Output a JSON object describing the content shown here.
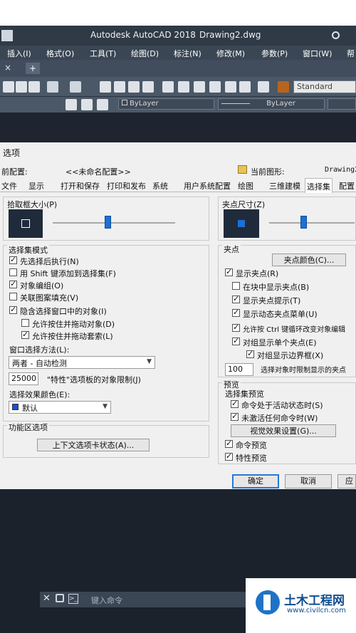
{
  "app": {
    "title": "Autodesk AutoCAD 2018",
    "document": "Drawing2.dwg"
  },
  "menubar": {
    "items": [
      "插入(I)",
      "格式(O)",
      "工具(T)",
      "绘图(D)",
      "标注(N)",
      "修改(M)",
      "参数(P)",
      "窗口(W)",
      "帮"
    ]
  },
  "toolbar": {
    "style_combo": "Standard",
    "layer_combo": "ByLayer",
    "linetype_combo": "ByLayer"
  },
  "dialog": {
    "title": "选项",
    "current_profile_label": "前配置:",
    "current_profile_value": "<<未命名配置>>",
    "current_drawing_label": "当前图形:",
    "current_drawing_value": "Drawing2",
    "tabs": [
      "文件",
      "显示",
      "打开和保存",
      "打印和发布",
      "系统",
      "用户系统配置",
      "绘图",
      "三维建模",
      "选择集",
      "配置"
    ],
    "active_tab": "选择集",
    "pickbox": {
      "label": "拾取框大小(P)",
      "slider_fraction": 0.45
    },
    "grip_size": {
      "label": "夹点尺寸(Z)",
      "slider_fraction": 0.35
    },
    "selection_modes": {
      "title": "选择集模式",
      "items": [
        {
          "label": "先选择后执行(N)",
          "checked": true
        },
        {
          "label": "用 Shift 键添加到选择集(F)",
          "checked": false
        },
        {
          "label": "对象编组(O)",
          "checked": true
        },
        {
          "label": "关联图案填充(V)",
          "checked": false
        },
        {
          "label": "隐含选择窗口中的对象(I)",
          "checked": true
        }
      ],
      "sub_items": [
        {
          "label": "允许按住并拖动对象(D)",
          "checked": false
        },
        {
          "label": "允许按住并拖动套索(L)",
          "checked": true
        }
      ],
      "window_method_label": "窗口选择方法(L):",
      "window_method_value": "两者 - 自动检测",
      "object_limit_value": "25000",
      "object_limit_label": "\"特性\"选项板的对象限制(J)",
      "effect_color_label": "选择效果颜色(E):",
      "effect_color_value": "默认",
      "effect_color_swatch": "#1a4fd6"
    },
    "ribbon_options": {
      "title": "功能区选项",
      "button": "上下文选项卡状态(A)..."
    },
    "grips": {
      "title": "夹点",
      "color_button": "夹点颜色(C)...",
      "items": [
        {
          "label": "显示夹点(R)",
          "checked": true,
          "indent": 0
        },
        {
          "label": "在块中显示夹点(B)",
          "checked": false,
          "indent": 1
        },
        {
          "label": "显示夹点提示(T)",
          "checked": true,
          "indent": 1
        },
        {
          "label": "显示动态夹点菜单(U)",
          "checked": true,
          "indent": 1
        },
        {
          "label": "允许按 Ctrl 键循环改变对象编辑",
          "checked": true,
          "indent": 1
        },
        {
          "label": "对组显示单个夹点(E)",
          "checked": true,
          "indent": 1
        },
        {
          "label": "对组显示边界框(X)",
          "checked": true,
          "indent": 2
        }
      ],
      "limit_value": "100",
      "limit_label": "选择对象时限制显示的夹点"
    },
    "preview": {
      "title": "预览",
      "subtitle": "选择集预览",
      "items": [
        {
          "label": "命令处于活动状态时(S)",
          "checked": true
        },
        {
          "label": "未激活任何命令时(W)",
          "checked": true
        }
      ],
      "visual_button": "视觉效果设置(G)...",
      "more": [
        {
          "label": "命令预览",
          "checked": true
        },
        {
          "label": "特性预览",
          "checked": true
        }
      ]
    },
    "buttons": {
      "ok": "确定",
      "cancel": "取消",
      "apply": "应"
    }
  },
  "commandline": {
    "placeholder": "键入命令"
  },
  "watermark": {
    "name": "土木工程网",
    "url": "www.civilcn.com"
  }
}
